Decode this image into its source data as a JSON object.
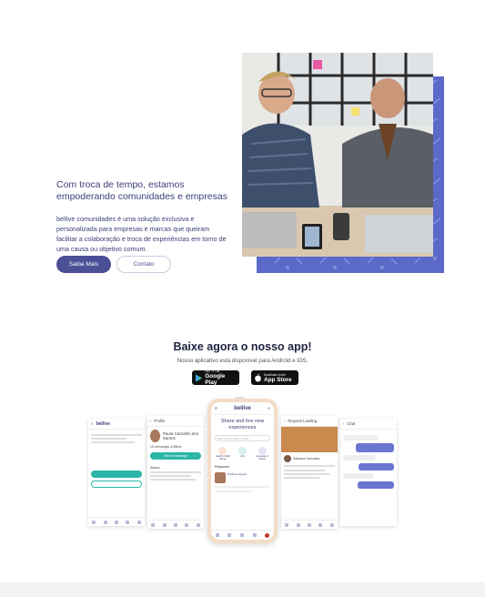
{
  "hero": {
    "title": "Com troca de tempo, estamos empoderando comunidades e empresas",
    "description": "bellive comunidades é uma solução exclusiva e personalizada para empresas e marcas que queiram facilitar a colaboração e troca de experiências em torno de uma causa ou objetivo comum.",
    "primary_button": "Saiba Mais",
    "secondary_button": "Contato"
  },
  "app_section": {
    "title": "Baixe agora o nosso app!",
    "subtitle": "Nosso aplicativo está disponível para Android e iOS.",
    "google_play": {
      "small": "GET IT ON",
      "large": "Google Play"
    },
    "app_store": {
      "small": "Download on the",
      "large": "App Store"
    }
  },
  "phone": {
    "brand": "bellive",
    "headline": "Share and live new experiences",
    "search_placeholder": "Search for a skill or hobby",
    "categories": [
      "Health & Well Being",
      "Arts",
      "Language & Culture"
    ],
    "section": "Requests",
    "request_title": "Student support"
  },
  "screens": {
    "left_brand": "bellive",
    "profile_header": "Profile",
    "profile_name": "Paula Carvalho dos Santos",
    "profile_stat": "15 exchanges in Bliivie",
    "profile_button": "Send a message",
    "profile_about": "About",
    "right_header": "Request Landing",
    "right_user": "Santana Gonzalez",
    "chat_header": "Chat"
  },
  "colors": {
    "accent": "#4b4f96",
    "photo_bg": "#5b6ac9",
    "teal": "#2bb6a8"
  }
}
